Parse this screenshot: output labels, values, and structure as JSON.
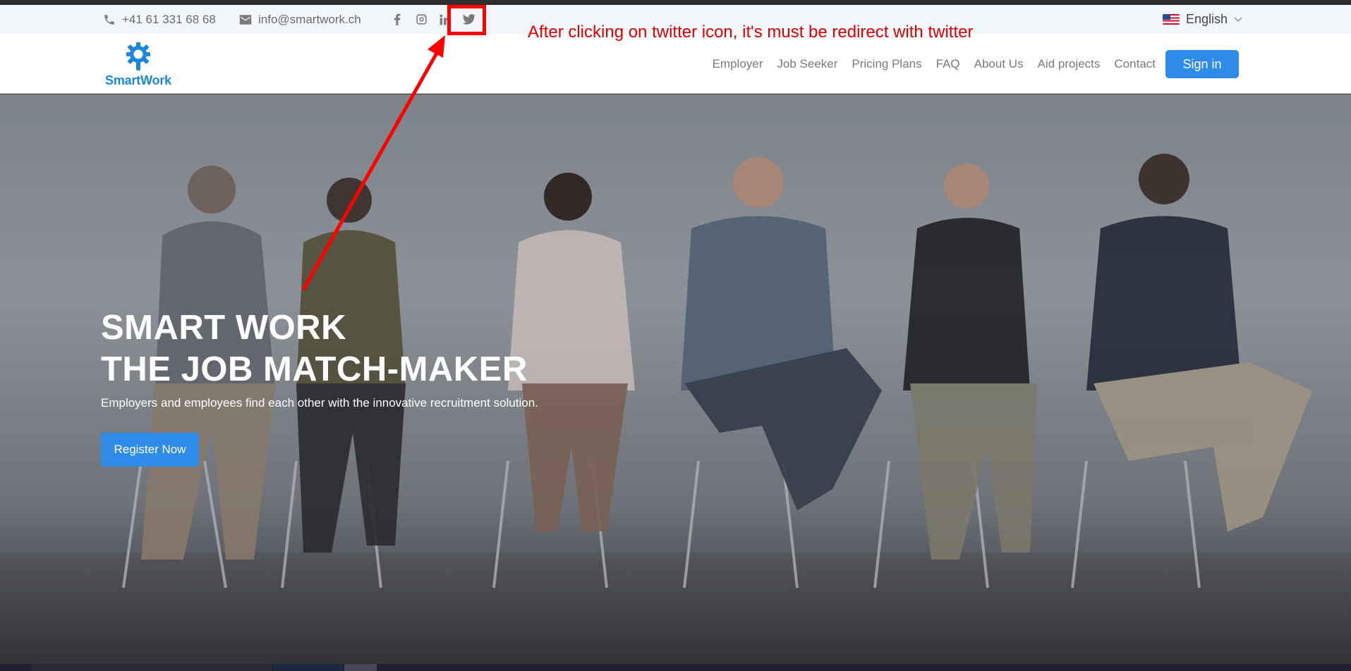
{
  "utility_bar": {
    "phone": "+41 61 331 68 68",
    "email": "info@smartwork.ch",
    "social_icons": [
      "facebook-icon",
      "instagram-icon",
      "linkedin-icon",
      "twitter-icon"
    ],
    "language": "English"
  },
  "header": {
    "logo_text": "SmartWork",
    "nav": [
      "Employer",
      "Job Seeker",
      "Pricing Plans",
      "FAQ",
      "About Us",
      "Aid projects",
      "Contact"
    ],
    "signin_label": "Sign in"
  },
  "hero": {
    "title_line1": "SMART WORK",
    "title_line2": "THE JOB MATCH-MAKER",
    "subtitle": "Employers and employees find each other with the innovative recruitment solution.",
    "cta_label": "Register Now"
  },
  "annotation": {
    "text": "After clicking on twitter icon, it's must be redirect with twitter"
  },
  "colors": {
    "brand_blue": "#2f8be8",
    "annotation_red": "#ff0000"
  }
}
